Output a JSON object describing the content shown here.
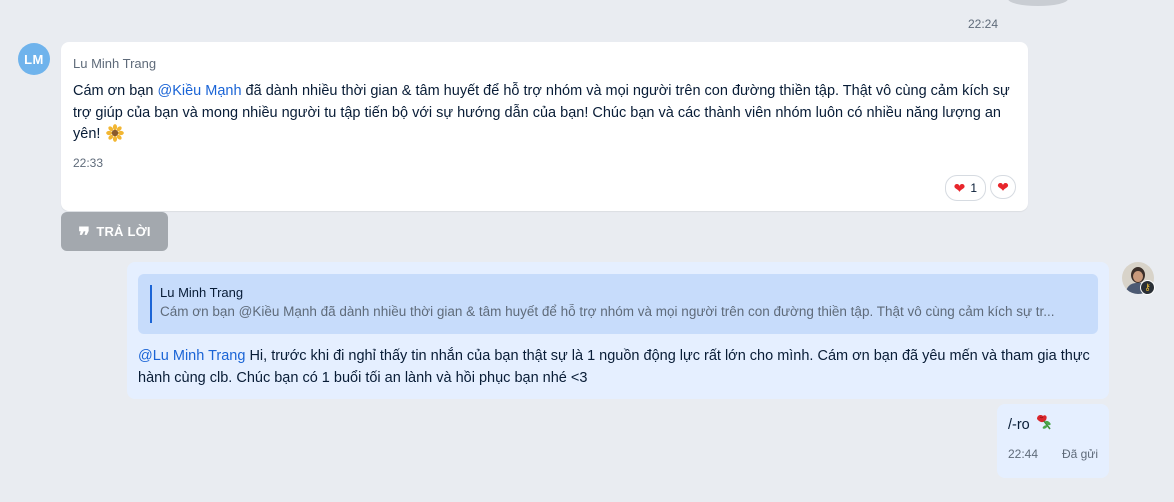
{
  "top_message": {
    "time": "22:24"
  },
  "incoming": {
    "avatar_initials": "LM",
    "sender": "Lu Minh Trang",
    "text_before_mention": "Cám ơn bạn ",
    "mention": "@Kiều Mạnh",
    "text_after_mention": " đã dành nhiều thời gian & tâm huyết để hỗ trợ nhóm và mọi người trên con đường thiền tập. Thật vô cùng cảm kích sự trợ giúp của bạn và mong nhiều người tu tập tiến bộ với sự hướng dẫn của bạn! Chúc bạn và các thành viên nhóm luôn có nhiều năng lượng an yên!",
    "emoji_icon": "sunflower-icon",
    "time": "22:33",
    "reaction_count": "1",
    "reaction_icon": "heart-icon"
  },
  "reply_button": {
    "label": "TRẢ LỜI"
  },
  "outgoing_reply": {
    "quote_sender": "Lu Minh Trang",
    "quote_text": "Cám ơn bạn @Kiều Mạnh đã dành nhiều thời gian & tâm huyết để hỗ trợ nhóm và mọi người trên con đường thiền tập. Thật vô cùng cảm kích sự tr...",
    "mention": "@Lu Minh Trang",
    "text": " Hi, trước khi đi nghỉ thấy tin nhắn của bạn thật sự là 1 nguồn động lực rất lớn cho mình. Cám ơn bạn đã yêu mến và tham gia thực hành cùng clb. Chúc bạn có 1 buổi tối an lành và hồi phục bạn nhé <3"
  },
  "outgoing_short": {
    "text": "/-ro",
    "emoji_icon": "rose-icon",
    "time": "22:44",
    "status": "Đã gửi"
  },
  "colors": {
    "background": "#e9ecf1",
    "mention": "#1a64d6",
    "my_bubble": "#e5efff",
    "quote_box": "#c7dcfb",
    "avatar": "#6fb3ec",
    "reply_button": "#a3a8ae",
    "heart": "#e8262c"
  }
}
